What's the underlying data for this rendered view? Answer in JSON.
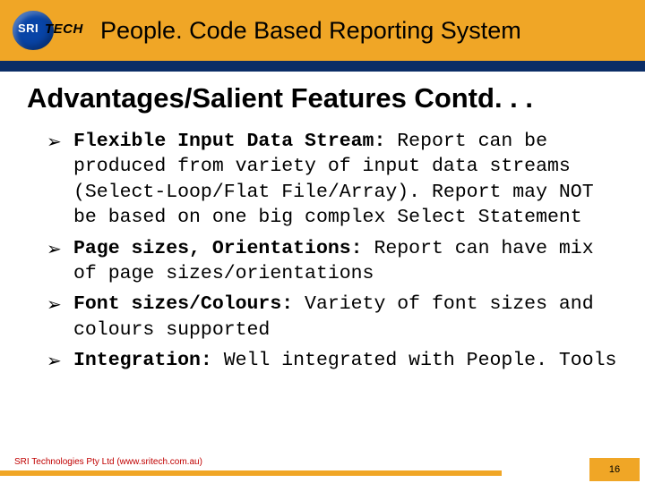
{
  "header": {
    "logo_sri": "SRI",
    "logo_tech": "TECH",
    "title": "People. Code Based Reporting System"
  },
  "heading": "Advantages/Salient Features Contd. . .",
  "bullets": [
    {
      "lead": "Flexible Input Data Stream:",
      "body": " Report can be produced from variety of input data streams (Select-Loop/Flat File/Array). Report may NOT be based on one big complex Select Statement"
    },
    {
      "lead": "Page sizes, Orientations:",
      "body": " Report can have mix of page sizes/orientations"
    },
    {
      "lead": "Font sizes/Colours:",
      "body": " Variety of font sizes and colours supported"
    },
    {
      "lead": "Integration:",
      "body": " Well integrated with People. Tools"
    }
  ],
  "footer": {
    "text": "SRI Technologies Pty Ltd (www.sritech.com.au)",
    "page": "16"
  }
}
